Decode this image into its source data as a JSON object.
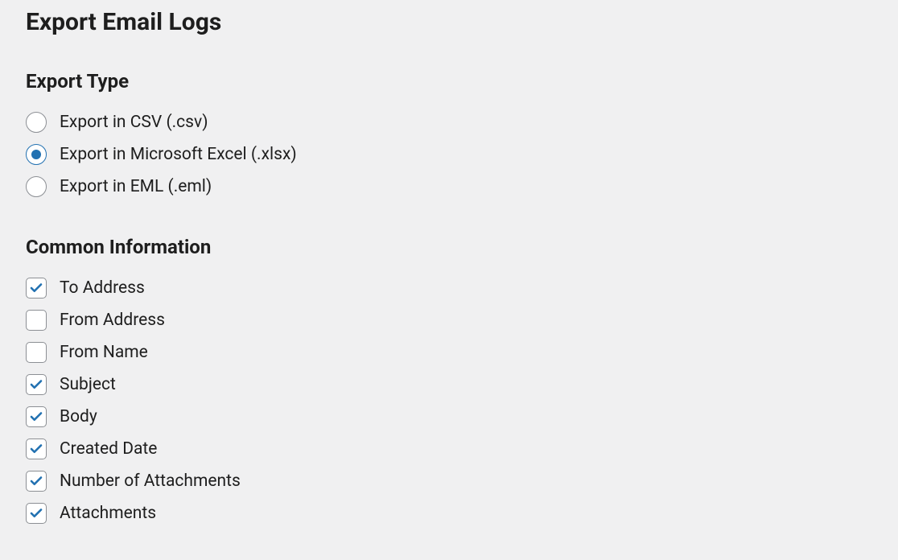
{
  "page_title": "Export Email Logs",
  "export_type": {
    "heading": "Export Type",
    "options": [
      {
        "label": "Export in CSV (.csv)",
        "selected": false
      },
      {
        "label": "Export in Microsoft Excel (.xlsx)",
        "selected": true
      },
      {
        "label": "Export in EML (.eml)",
        "selected": false
      }
    ]
  },
  "common_information": {
    "heading": "Common Information",
    "options": [
      {
        "label": "To Address",
        "checked": true
      },
      {
        "label": "From Address",
        "checked": false
      },
      {
        "label": "From Name",
        "checked": false
      },
      {
        "label": "Subject",
        "checked": true
      },
      {
        "label": "Body",
        "checked": true
      },
      {
        "label": "Created Date",
        "checked": true
      },
      {
        "label": "Number of Attachments",
        "checked": true
      },
      {
        "label": "Attachments",
        "checked": true
      }
    ]
  }
}
